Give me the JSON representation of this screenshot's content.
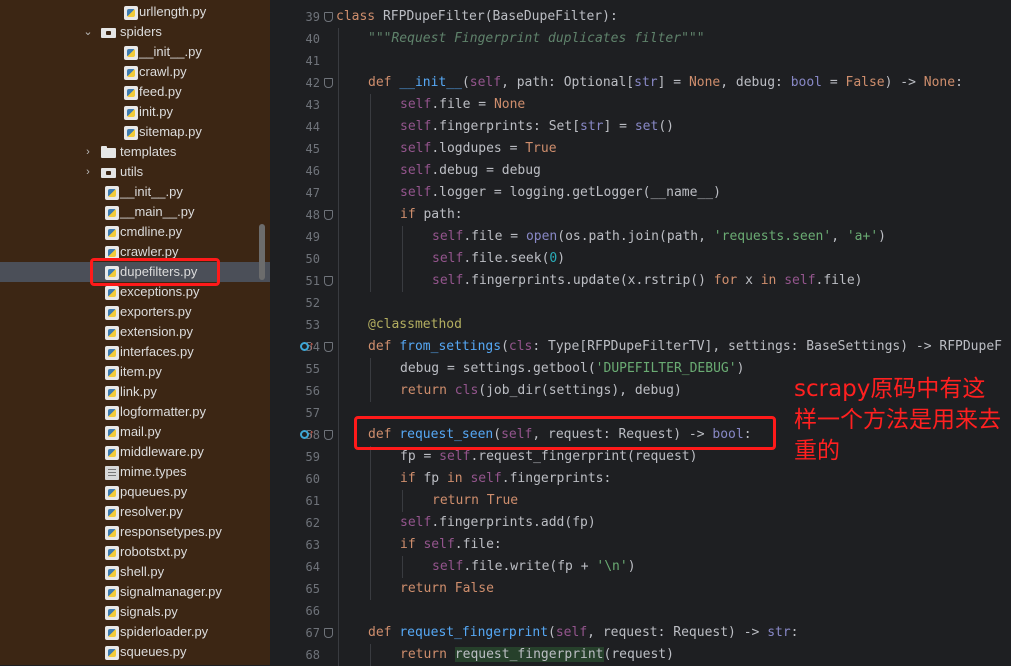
{
  "project_tree": {
    "rows": [
      {
        "label": "urllength.py",
        "type": "py",
        "depth": 3
      },
      {
        "label": "spiders",
        "type": "pkg",
        "depth": 2,
        "expanded": true
      },
      {
        "label": "__init__.py",
        "type": "py",
        "depth": 3
      },
      {
        "label": "crawl.py",
        "type": "py",
        "depth": 3
      },
      {
        "label": "feed.py",
        "type": "py",
        "depth": 3
      },
      {
        "label": "init.py",
        "type": "py",
        "depth": 3
      },
      {
        "label": "sitemap.py",
        "type": "py",
        "depth": 3
      },
      {
        "label": "templates",
        "type": "dir",
        "depth": 2,
        "expanded": false
      },
      {
        "label": "utils",
        "type": "pkg",
        "depth": 2,
        "expanded": false
      },
      {
        "label": "__init__.py",
        "type": "py",
        "depth": 2
      },
      {
        "label": "__main__.py",
        "type": "py",
        "depth": 2
      },
      {
        "label": "cmdline.py",
        "type": "py",
        "depth": 2
      },
      {
        "label": "crawler.py",
        "type": "py",
        "depth": 2
      },
      {
        "label": "dupefilters.py",
        "type": "py",
        "depth": 2,
        "selected": true
      },
      {
        "label": "exceptions.py",
        "type": "py",
        "depth": 2
      },
      {
        "label": "exporters.py",
        "type": "py",
        "depth": 2
      },
      {
        "label": "extension.py",
        "type": "py",
        "depth": 2
      },
      {
        "label": "interfaces.py",
        "type": "py",
        "depth": 2
      },
      {
        "label": "item.py",
        "type": "py",
        "depth": 2
      },
      {
        "label": "link.py",
        "type": "py",
        "depth": 2
      },
      {
        "label": "logformatter.py",
        "type": "py",
        "depth": 2
      },
      {
        "label": "mail.py",
        "type": "py",
        "depth": 2
      },
      {
        "label": "middleware.py",
        "type": "py",
        "depth": 2
      },
      {
        "label": "mime.types",
        "type": "txt",
        "depth": 2
      },
      {
        "label": "pqueues.py",
        "type": "py",
        "depth": 2
      },
      {
        "label": "resolver.py",
        "type": "py",
        "depth": 2
      },
      {
        "label": "responsetypes.py",
        "type": "py",
        "depth": 2
      },
      {
        "label": "robotstxt.py",
        "type": "py",
        "depth": 2
      },
      {
        "label": "shell.py",
        "type": "py",
        "depth": 2
      },
      {
        "label": "signalmanager.py",
        "type": "py",
        "depth": 2
      },
      {
        "label": "signals.py",
        "type": "py",
        "depth": 2
      },
      {
        "label": "spiderloader.py",
        "type": "py",
        "depth": 2
      },
      {
        "label": "squeues.py",
        "type": "py",
        "depth": 2
      }
    ]
  },
  "editor": {
    "lines": [
      {
        "n": "39",
        "indent": 0,
        "tokens": [
          [
            "kw",
            "class "
          ],
          [
            "",
            "RFPDupeFilter(BaseDupeFilter):"
          ]
        ]
      },
      {
        "n": "40",
        "indent": 1,
        "tokens": [
          [
            "cm",
            "\"\"\"Request Fingerprint duplicates filter\"\"\""
          ]
        ]
      },
      {
        "n": "41",
        "indent": 0,
        "tokens": []
      },
      {
        "n": "42",
        "indent": 1,
        "tokens": [
          [
            "kw",
            "def "
          ],
          [
            "fn",
            "__init__"
          ],
          [
            "",
            "("
          ],
          [
            "slf",
            "self"
          ],
          [
            "",
            ", path: Optional["
          ],
          [
            "bi",
            "str"
          ],
          [
            "",
            "] = "
          ],
          [
            "kw",
            "None"
          ],
          [
            "",
            ", debug: "
          ],
          [
            "bi",
            "bool"
          ],
          [
            "",
            " = "
          ],
          [
            "kw",
            "False"
          ],
          [
            "",
            ") -> "
          ],
          [
            "kw",
            "None"
          ],
          [
            "",
            ":"
          ]
        ]
      },
      {
        "n": "43",
        "indent": 2,
        "tokens": [
          [
            "slf",
            "self"
          ],
          [
            "",
            ".file = "
          ],
          [
            "kw",
            "None"
          ]
        ]
      },
      {
        "n": "44",
        "indent": 2,
        "tokens": [
          [
            "slf",
            "self"
          ],
          [
            "",
            ".fingerprints: Set["
          ],
          [
            "bi",
            "str"
          ],
          [
            "",
            "] = "
          ],
          [
            "bi",
            "set"
          ],
          [
            "",
            "()"
          ]
        ]
      },
      {
        "n": "45",
        "indent": 2,
        "tokens": [
          [
            "slf",
            "self"
          ],
          [
            "",
            ".logdupes = "
          ],
          [
            "kw",
            "True"
          ]
        ]
      },
      {
        "n": "46",
        "indent": 2,
        "tokens": [
          [
            "slf",
            "self"
          ],
          [
            "",
            ".debug = debug"
          ]
        ]
      },
      {
        "n": "47",
        "indent": 2,
        "tokens": [
          [
            "slf",
            "self"
          ],
          [
            "",
            ".logger = logging.getLogger(__name__)"
          ]
        ]
      },
      {
        "n": "48",
        "indent": 2,
        "tokens": [
          [
            "kw",
            "if "
          ],
          [
            "",
            "path:"
          ]
        ]
      },
      {
        "n": "49",
        "indent": 3,
        "tokens": [
          [
            "slf",
            "self"
          ],
          [
            "",
            ".file = "
          ],
          [
            "bi",
            "open"
          ],
          [
            "",
            "(os.path.join(path, "
          ],
          [
            "st",
            "'requests.seen'"
          ],
          [
            "",
            ", "
          ],
          [
            "st",
            "'a+'"
          ],
          [
            "",
            ")"
          ]
        ]
      },
      {
        "n": "50",
        "indent": 3,
        "tokens": [
          [
            "slf",
            "self"
          ],
          [
            "",
            ".file.seek("
          ],
          [
            "nu",
            "0"
          ],
          [
            "",
            ")"
          ]
        ]
      },
      {
        "n": "51",
        "indent": 3,
        "tokens": [
          [
            "slf",
            "self"
          ],
          [
            "",
            ".fingerprints.update(x.rstrip() "
          ],
          [
            "kw",
            "for "
          ],
          [
            "",
            "x "
          ],
          [
            "kw",
            "in "
          ],
          [
            "slf",
            "self"
          ],
          [
            "",
            ".file)"
          ]
        ]
      },
      {
        "n": "52",
        "indent": 0,
        "tokens": []
      },
      {
        "n": "53",
        "indent": 1,
        "tokens": [
          [
            "dec",
            "@classmethod"
          ]
        ]
      },
      {
        "n": "54",
        "indent": 1,
        "tokens": [
          [
            "kw",
            "def "
          ],
          [
            "fn",
            "from_settings"
          ],
          [
            "",
            "("
          ],
          [
            "slf",
            "cls"
          ],
          [
            "",
            ": Type[RFPDupeFilterTV], settings: BaseSettings) -> RFPDupeF"
          ]
        ]
      },
      {
        "n": "55",
        "indent": 2,
        "tokens": [
          [
            "",
            "debug = settings.getbool("
          ],
          [
            "st",
            "'DUPEFILTER_DEBUG'"
          ],
          [
            "",
            ")"
          ]
        ]
      },
      {
        "n": "56",
        "indent": 2,
        "tokens": [
          [
            "kw",
            "return "
          ],
          [
            "slf",
            "cls"
          ],
          [
            "",
            "(job_dir(settings), debug)"
          ]
        ]
      },
      {
        "n": "57",
        "indent": 0,
        "tokens": []
      },
      {
        "n": "58",
        "indent": 1,
        "tokens": [
          [
            "kw",
            "def "
          ],
          [
            "fn",
            "request_seen"
          ],
          [
            "",
            "("
          ],
          [
            "slf",
            "self"
          ],
          [
            "",
            ", request: Request) -> "
          ],
          [
            "bi",
            "bool"
          ],
          [
            "",
            ":"
          ]
        ]
      },
      {
        "n": "59",
        "indent": 2,
        "tokens": [
          [
            "",
            "fp = "
          ],
          [
            "slf",
            "self"
          ],
          [
            "",
            ".request_fingerprint(request)"
          ]
        ]
      },
      {
        "n": "60",
        "indent": 2,
        "tokens": [
          [
            "kw",
            "if "
          ],
          [
            "",
            "fp "
          ],
          [
            "kw",
            "in "
          ],
          [
            "slf",
            "self"
          ],
          [
            "",
            ".fingerprints:"
          ]
        ]
      },
      {
        "n": "61",
        "indent": 3,
        "tokens": [
          [
            "kw",
            "return True"
          ]
        ]
      },
      {
        "n": "62",
        "indent": 2,
        "tokens": [
          [
            "slf",
            "self"
          ],
          [
            "",
            ".fingerprints.add(fp)"
          ]
        ]
      },
      {
        "n": "63",
        "indent": 2,
        "tokens": [
          [
            "kw",
            "if "
          ],
          [
            "slf",
            "self"
          ],
          [
            "",
            ".file:"
          ]
        ]
      },
      {
        "n": "64",
        "indent": 3,
        "tokens": [
          [
            "slf",
            "self"
          ],
          [
            "",
            ".file.write(fp + "
          ],
          [
            "st",
            "'\\n'"
          ],
          [
            "",
            ")"
          ]
        ]
      },
      {
        "n": "65",
        "indent": 2,
        "tokens": [
          [
            "kw",
            "return False"
          ]
        ]
      },
      {
        "n": "66",
        "indent": 0,
        "tokens": []
      },
      {
        "n": "67",
        "indent": 1,
        "tokens": [
          [
            "kw",
            "def "
          ],
          [
            "fn",
            "request_fingerprint"
          ],
          [
            "",
            "("
          ],
          [
            "slf",
            "self"
          ],
          [
            "",
            ", request: Request) -> "
          ],
          [
            "bi",
            "str"
          ],
          [
            "",
            ":"
          ]
        ]
      },
      {
        "n": "68",
        "indent": 2,
        "tokens": [
          [
            "kw",
            "return "
          ],
          [
            "hl",
            "request_fingerprint"
          ],
          [
            "",
            "(request)"
          ]
        ]
      }
    ]
  },
  "annotation": {
    "note": "scrapy原码中有这样一个方法是用来去重的",
    "color": "#ff1a1a"
  }
}
